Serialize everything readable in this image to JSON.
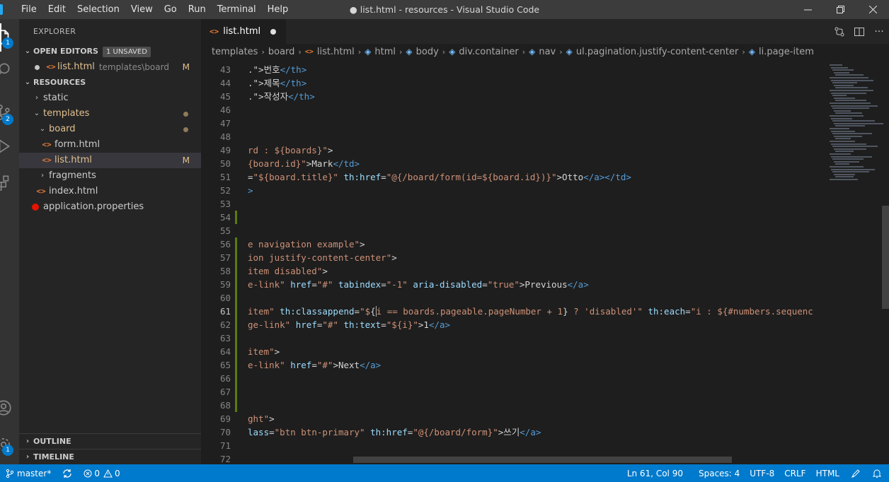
{
  "menu": {
    "items": [
      "File",
      "Edit",
      "Selection",
      "View",
      "Go",
      "Run",
      "Terminal",
      "Help"
    ]
  },
  "window": {
    "title": "● list.html - resources - Visual Studio Code"
  },
  "activity": {
    "explorer_badge": "1",
    "scm_badge": "2",
    "settings_badge": "1"
  },
  "sidebar": {
    "title": "EXPLORER",
    "open_editors": {
      "label": "OPEN EDITORS",
      "badge": "1 UNSAVED",
      "items": [
        {
          "name": "list.html",
          "description": "templates\\board",
          "status": "M"
        }
      ]
    },
    "resources": {
      "label": "RESOURCES",
      "tree": [
        {
          "name": "static"
        },
        {
          "name": "templates"
        },
        {
          "name": "board"
        },
        {
          "name": "form.html"
        },
        {
          "name": "list.html",
          "status": "M"
        },
        {
          "name": "fragments"
        },
        {
          "name": "index.html"
        },
        {
          "name": "application.properties"
        }
      ]
    },
    "outline_label": "OUTLINE",
    "timeline_label": "TIMELINE"
  },
  "tab": {
    "label": "list.html"
  },
  "breadcrumb": [
    "templates",
    "board",
    "list.html",
    "html",
    "body",
    "div.container",
    "nav",
    "ul.pagination.justify-content-center",
    "li.page-item"
  ],
  "code_lines": [
    {
      "n": "43",
      "parts": [
        {
          "t": "txt",
          "v": ".\">"
        },
        {
          "t": "txt",
          "v": "번호"
        },
        {
          "t": "tag",
          "v": "</th>"
        }
      ]
    },
    {
      "n": "44",
      "parts": [
        {
          "t": "txt",
          "v": ".\">"
        },
        {
          "t": "txt",
          "v": "제목"
        },
        {
          "t": "tag",
          "v": "</th>"
        }
      ]
    },
    {
      "n": "45",
      "parts": [
        {
          "t": "txt",
          "v": ".\">"
        },
        {
          "t": "txt",
          "v": "작성자"
        },
        {
          "t": "tag",
          "v": "</th>"
        }
      ]
    },
    {
      "n": "46",
      "parts": []
    },
    {
      "n": "47",
      "parts": []
    },
    {
      "n": "48",
      "parts": []
    },
    {
      "n": "49",
      "parts": [
        {
          "t": "str",
          "v": "rd : ${boards}\""
        },
        {
          "t": "txt",
          "v": ">"
        }
      ]
    },
    {
      "n": "50",
      "parts": [
        {
          "t": "str",
          "v": "{board.id}\""
        },
        {
          "t": "txt",
          "v": ">Mark"
        },
        {
          "t": "tag",
          "v": "</td>"
        }
      ]
    },
    {
      "n": "51",
      "parts": [
        {
          "t": "txt",
          "v": "="
        },
        {
          "t": "str",
          "v": "\"${board.title}\""
        },
        {
          "t": "txt",
          "v": " "
        },
        {
          "t": "attr",
          "v": "th:href"
        },
        {
          "t": "txt",
          "v": "="
        },
        {
          "t": "str",
          "v": "\"@{/board/form(id=${board.id})}\""
        },
        {
          "t": "txt",
          "v": ">Otto"
        },
        {
          "t": "tag",
          "v": "</a></td>"
        }
      ]
    },
    {
      "n": "52",
      "parts": [
        {
          "t": "tag",
          "v": ">"
        }
      ]
    },
    {
      "n": "53",
      "parts": []
    },
    {
      "n": "54",
      "parts": []
    },
    {
      "n": "55",
      "parts": []
    },
    {
      "n": "56",
      "parts": [
        {
          "t": "str",
          "v": "e navigation example\""
        },
        {
          "t": "txt",
          "v": ">"
        }
      ]
    },
    {
      "n": "57",
      "parts": [
        {
          "t": "str",
          "v": "ion justify-content-center\""
        },
        {
          "t": "txt",
          "v": ">"
        }
      ]
    },
    {
      "n": "58",
      "parts": [
        {
          "t": "str",
          "v": "item disabled\""
        },
        {
          "t": "txt",
          "v": ">"
        }
      ]
    },
    {
      "n": "59",
      "parts": [
        {
          "t": "str",
          "v": "e-link\""
        },
        {
          "t": "txt",
          "v": " "
        },
        {
          "t": "attr",
          "v": "href"
        },
        {
          "t": "txt",
          "v": "="
        },
        {
          "t": "str",
          "v": "\"#\""
        },
        {
          "t": "txt",
          "v": " "
        },
        {
          "t": "attr",
          "v": "tabindex"
        },
        {
          "t": "txt",
          "v": "="
        },
        {
          "t": "str",
          "v": "\"-1\""
        },
        {
          "t": "txt",
          "v": " "
        },
        {
          "t": "attr",
          "v": "aria-disabled"
        },
        {
          "t": "txt",
          "v": "="
        },
        {
          "t": "str",
          "v": "\"true\""
        },
        {
          "t": "txt",
          "v": ">Previous"
        },
        {
          "t": "tag",
          "v": "</a>"
        }
      ]
    },
    {
      "n": "60",
      "parts": []
    },
    {
      "n": "61",
      "parts": [
        {
          "t": "str",
          "v": "item\""
        },
        {
          "t": "txt",
          "v": " "
        },
        {
          "t": "attr",
          "v": "th:classappend"
        },
        {
          "t": "txt",
          "v": "="
        },
        {
          "t": "str",
          "v": "\"$"
        },
        {
          "t": "txt",
          "v": "{"
        },
        {
          "t": "str",
          "v": "i == boards.pageable.pageNumber + 1"
        },
        {
          "t": "txt",
          "v": "}"
        },
        {
          "t": "str",
          "v": " ? 'disabled'\""
        },
        {
          "t": "txt",
          "v": " "
        },
        {
          "t": "attr",
          "v": "th:each"
        },
        {
          "t": "txt",
          "v": "="
        },
        {
          "t": "str",
          "v": "\"i : ${#numbers.sequenc"
        }
      ]
    },
    {
      "n": "62",
      "parts": [
        {
          "t": "str",
          "v": "ge-link\""
        },
        {
          "t": "txt",
          "v": " "
        },
        {
          "t": "attr",
          "v": "href"
        },
        {
          "t": "txt",
          "v": "="
        },
        {
          "t": "str",
          "v": "\"#\""
        },
        {
          "t": "txt",
          "v": " "
        },
        {
          "t": "attr",
          "v": "th:text"
        },
        {
          "t": "txt",
          "v": "="
        },
        {
          "t": "str",
          "v": "\"${i}\""
        },
        {
          "t": "txt",
          "v": ">1"
        },
        {
          "t": "tag",
          "v": "</a>"
        }
      ]
    },
    {
      "n": "63",
      "parts": []
    },
    {
      "n": "64",
      "parts": [
        {
          "t": "str",
          "v": "item\""
        },
        {
          "t": "txt",
          "v": ">"
        }
      ]
    },
    {
      "n": "65",
      "parts": [
        {
          "t": "str",
          "v": "e-link\""
        },
        {
          "t": "txt",
          "v": " "
        },
        {
          "t": "attr",
          "v": "href"
        },
        {
          "t": "txt",
          "v": "="
        },
        {
          "t": "str",
          "v": "\"#\""
        },
        {
          "t": "txt",
          "v": ">Next"
        },
        {
          "t": "tag",
          "v": "</a>"
        }
      ]
    },
    {
      "n": "66",
      "parts": []
    },
    {
      "n": "67",
      "parts": []
    },
    {
      "n": "68",
      "parts": []
    },
    {
      "n": "69",
      "parts": [
        {
          "t": "str",
          "v": "ght\""
        },
        {
          "t": "txt",
          "v": ">"
        }
      ]
    },
    {
      "n": "70",
      "parts": [
        {
          "t": "attr",
          "v": "lass"
        },
        {
          "t": "txt",
          "v": "="
        },
        {
          "t": "str",
          "v": "\"btn btn-primary\""
        },
        {
          "t": "txt",
          "v": " "
        },
        {
          "t": "attr",
          "v": "th:href"
        },
        {
          "t": "txt",
          "v": "="
        },
        {
          "t": "str",
          "v": "\"@{/board/form}\""
        },
        {
          "t": "txt",
          "v": ">쓰기"
        },
        {
          "t": "tag",
          "v": "</a>"
        }
      ]
    },
    {
      "n": "71",
      "parts": []
    },
    {
      "n": "72",
      "parts": []
    }
  ],
  "status": {
    "branch": "master*",
    "errors": "0",
    "warnings": "0",
    "position": "Ln 61, Col 90",
    "spaces": "Spaces: 4",
    "encoding": "UTF-8",
    "eol": "CRLF",
    "language": "HTML"
  },
  "colors": {
    "statusbar": "#007acc",
    "activitybar": "#333333",
    "sidebar": "#252526",
    "editor": "#1e1e1e"
  }
}
